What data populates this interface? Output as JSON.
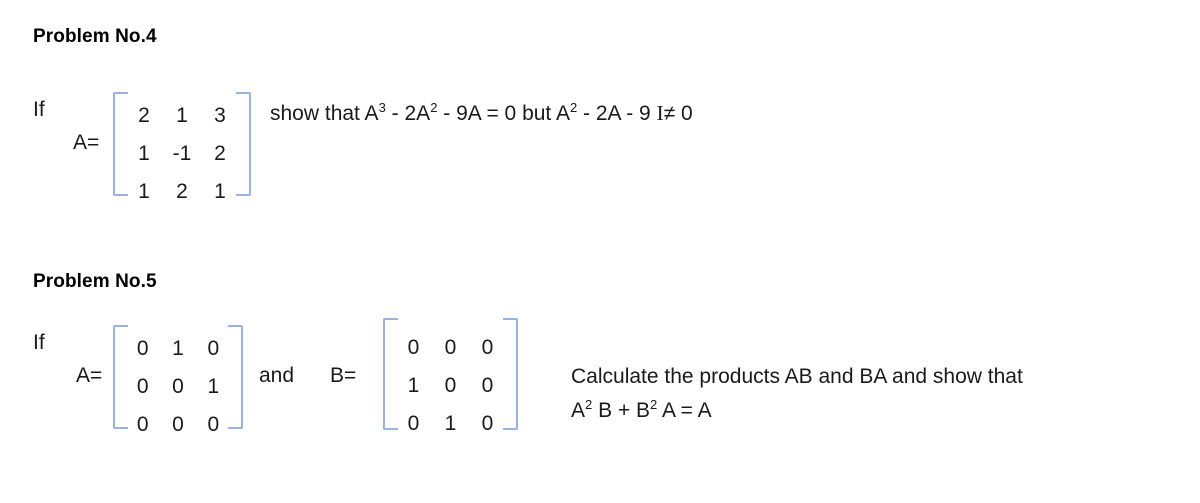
{
  "page": {
    "background_color": "#ffffff",
    "text_color": "#1a1a1a",
    "bracket_color": "#9ab3e0"
  },
  "problem4": {
    "heading": "Problem No.4",
    "if_label": "If",
    "matrix_label": "A=",
    "matrix_a": {
      "rows": [
        [
          "2",
          "1",
          "3"
        ],
        [
          "1",
          "-1",
          "2"
        ],
        [
          "1",
          "2",
          "1"
        ]
      ]
    },
    "statement": {
      "lead": "show that A",
      "exp1": "3",
      "mid1": " -  2A",
      "exp2": "2",
      "mid2": " -  9A = 0  but  A",
      "exp3": "2",
      "mid3": " -  2A  -  9 ",
      "identity": "I",
      "tail": "≠ 0"
    }
  },
  "problem5": {
    "heading": "Problem No.5",
    "if_label": "If",
    "matrix_a_label": "A=",
    "conjunction": "and",
    "matrix_b_label": "B=",
    "matrix_a": {
      "rows": [
        [
          "0",
          "1",
          "0"
        ],
        [
          "0",
          "0",
          "1"
        ],
        [
          "0",
          "0",
          "0"
        ]
      ]
    },
    "matrix_b": {
      "rows": [
        [
          "0",
          "0",
          "0"
        ],
        [
          "1",
          "0",
          "0"
        ],
        [
          "0",
          "1",
          "0"
        ]
      ]
    },
    "statement": {
      "line1": "Calculate the products AB and BA and show that",
      "line2_a": "A",
      "line2_exp1": "2",
      "line2_b": " B  +  B",
      "line2_exp2": "2",
      "line2_c": " A  =  A"
    }
  }
}
